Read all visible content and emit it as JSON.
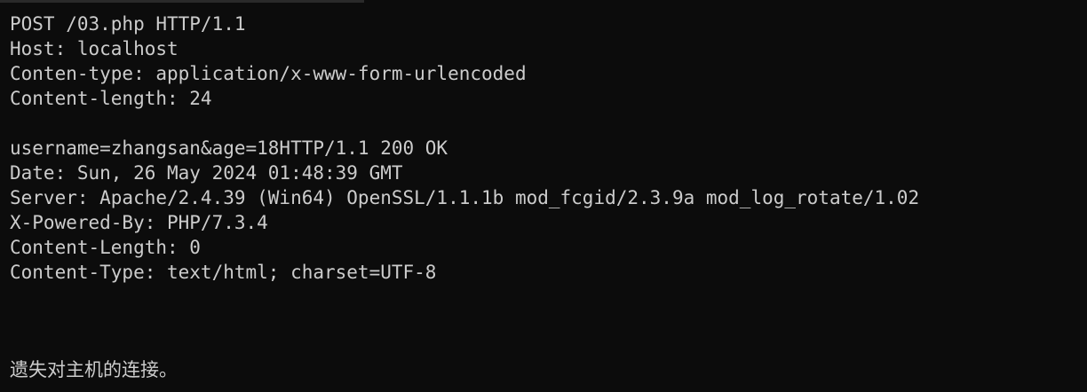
{
  "terminal": {
    "lines": [
      "POST /03.php HTTP/1.1",
      "Host: localhost",
      "Conten-type: application/x-www-form-urlencoded",
      "Content-length: 24",
      "",
      "username=zhangsan&age=18HTTP/1.1 200 OK",
      "Date: Sun, 26 May 2024 01:48:39 GMT",
      "Server: Apache/2.4.39 (Win64) OpenSSL/1.1.1b mod_fcgid/2.3.9a mod_log_rotate/1.02",
      "X-Powered-By: PHP/7.3.4",
      "Content-Length: 0",
      "Content-Type: text/html; charset=UTF-8"
    ],
    "status_message": "遗失对主机的连接。"
  },
  "colors": {
    "background": "#0c0c0c",
    "foreground": "#cccccc"
  }
}
